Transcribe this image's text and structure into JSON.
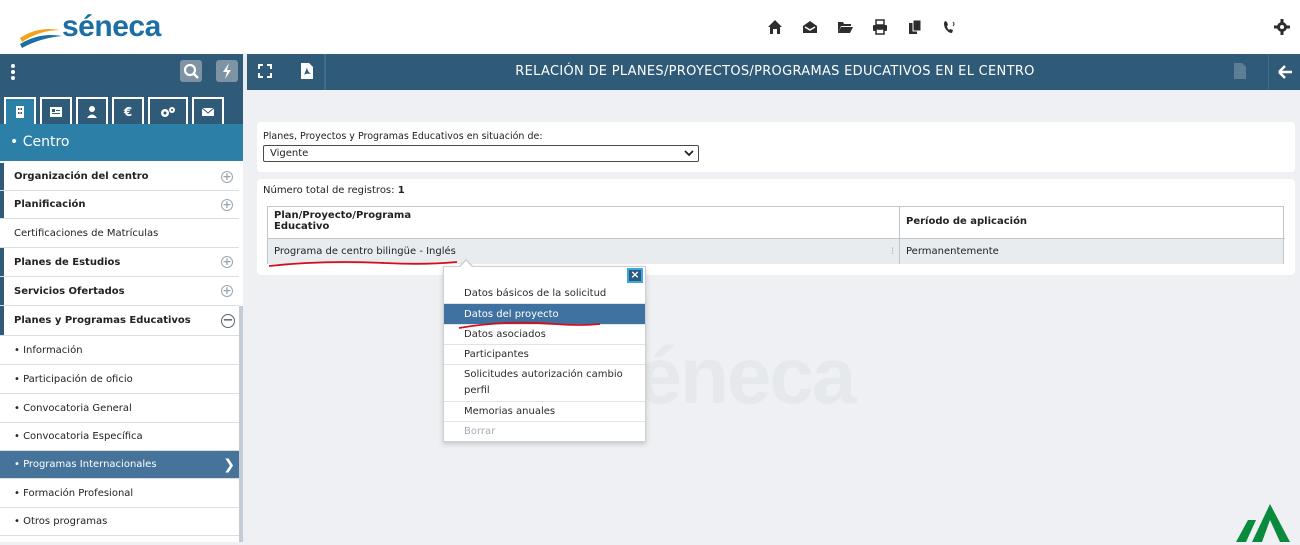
{
  "topbar": {
    "logo_text": "séneca",
    "icons": [
      "home-icon",
      "inbox-icon",
      "folder-icon",
      "print-icon",
      "documents-icon",
      "phone-icon"
    ],
    "settings_icon": "gear-icon"
  },
  "toolbar": {
    "title": "RELACIÓN DE PLANES/PROYECTOS/PROGRAMAS EDUCATIVOS EN EL CENTRO"
  },
  "sidebar": {
    "tabs": [
      "building-icon",
      "id-card-icon",
      "user-icon",
      "euro-icon",
      "gears-icon",
      "mail-icon"
    ],
    "tab_euro": "€",
    "section": "• Centro",
    "items": [
      {
        "label": "Organización del centro",
        "bold": true
      },
      {
        "label": "Planificación",
        "bold": true
      },
      {
        "label": "Certificaciones de Matrículas",
        "bold": false
      },
      {
        "label": "Planes de Estudios",
        "bold": true
      },
      {
        "label": "Servicios Ofertados",
        "bold": true
      },
      {
        "label": "Planes y Programas Educativos",
        "bold": true
      },
      {
        "label": "• Información",
        "bold": false
      },
      {
        "label": "• Participación de oficio",
        "bold": false
      },
      {
        "label": "• Convocatoria General",
        "bold": false
      },
      {
        "label": "• Convocatoria Específica",
        "bold": false
      },
      {
        "label": "• Programas Internacionales",
        "bold": false
      },
      {
        "label": "• Formación Profesional",
        "bold": false
      },
      {
        "label": "• Otros programas",
        "bold": false
      }
    ]
  },
  "filter": {
    "label": "Planes, Proyectos y Programas Educativos en situación de:",
    "selected": "Vigente"
  },
  "results": {
    "count_label": "Número total de registros:",
    "count": "1",
    "columns": [
      "Plan/Proyecto/Programa Educativo",
      "Período de aplicación"
    ],
    "column1_line1": "Plan/Proyecto/Programa",
    "column1_line2": "Educativo",
    "rows": [
      {
        "plan": "Programa de centro bilingüe - Inglés",
        "periodo": "Permanentemente"
      }
    ]
  },
  "context_menu": {
    "items": [
      {
        "label": "Datos básicos de la solicitud",
        "state": "normal"
      },
      {
        "label": "Datos del proyecto",
        "state": "active"
      },
      {
        "label": "Datos asociados",
        "state": "normal"
      },
      {
        "label": "Participantes",
        "state": "normal"
      },
      {
        "label": "Solicitudes autorización cambio perfil",
        "state": "normal"
      },
      {
        "label": "Memorias anuales",
        "state": "normal"
      },
      {
        "label": "Borrar",
        "state": "disabled"
      }
    ],
    "close_label": "×"
  },
  "watermark": "séneca",
  "colors": {
    "brand_dark": "#2f5a78",
    "brand_section": "#2c7fa7",
    "selection": "#45739a",
    "annotation_red": "#d0101e"
  }
}
